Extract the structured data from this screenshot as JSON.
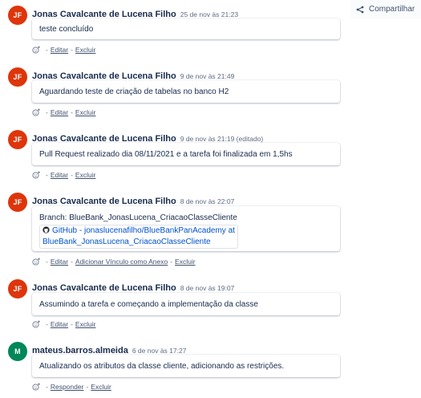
{
  "share": {
    "label": "Compartilhar",
    "icon": "share-icon"
  },
  "comments": [
    {
      "avatar": "JF",
      "avatar_color": "#de350b",
      "author": "Jonas Cavalcante de Lucena Filho",
      "date": "25 de nov às 21:23",
      "body": "teste concluído",
      "actions": [
        "Editar",
        "Excluir"
      ]
    },
    {
      "avatar": "JF",
      "avatar_color": "#de350b",
      "author": "Jonas Cavalcante de Lucena Filho",
      "date": "9 de nov às 21:49",
      "body": "Aguardando teste de criação de tabelas no banco H2",
      "actions": [
        "Editar",
        "Excluir"
      ]
    },
    {
      "avatar": "JF",
      "avatar_color": "#de350b",
      "author": "Jonas Cavalcante de Lucena Filho",
      "date": "9 de nov às 21:19 (editado)",
      "body": "Pull Request realizado dia 08/11/2021 e a tarefa foi finalizada em 1,5hs",
      "actions": [
        "Editar",
        "Excluir"
      ]
    },
    {
      "avatar": "JF",
      "avatar_color": "#de350b",
      "author": "Jonas Cavalcante de Lucena Filho",
      "date": "8 de nov às 22:07",
      "body": "Branch: BlueBank_JonasLucena_CriacaoClasseCliente",
      "link_line1": "GitHub - jonaslucenafilho/BlueBankPanAcademy at",
      "link_line2": "BlueBank_JonasLucena_CriacaoClasseCliente",
      "actions": [
        "Editar",
        "Adicionar Vínculo como Anexo",
        "Excluir"
      ]
    },
    {
      "avatar": "JF",
      "avatar_color": "#de350b",
      "author": "Jonas Cavalcante de Lucena Filho",
      "date": "8 de nov às 19:07",
      "body": "Assumindo a tarefa e começando a implementação da classe",
      "actions": [
        "Editar",
        "Excluir"
      ]
    },
    {
      "avatar": "M",
      "avatar_color": "#00875a",
      "author": "mateus.barros.almeida",
      "date": "6 de nov às 17:27",
      "body": "Atualizando os atributos da classe cliente, adicionando as restrições.",
      "actions": [
        "Responder",
        "Excluir"
      ]
    }
  ]
}
